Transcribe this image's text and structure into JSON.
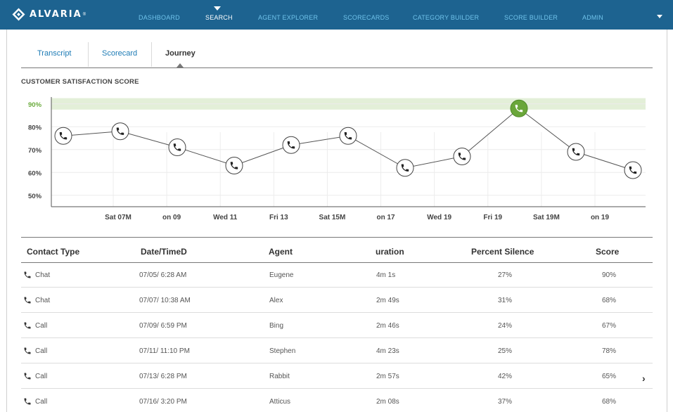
{
  "brand": {
    "name": "ALVARIA",
    "mark": "®"
  },
  "nav": {
    "items": [
      {
        "id": "dashboard",
        "label": "DASHBOARD"
      },
      {
        "id": "search",
        "label": "SEARCH",
        "active": true
      },
      {
        "id": "agent-explorer",
        "label": "AGENT EXPLORER"
      },
      {
        "id": "scorecards",
        "label": "SCORECARDS"
      },
      {
        "id": "category-builder",
        "label": "CATEGORY BUILDER"
      },
      {
        "id": "score-builder",
        "label": "SCORE BUILDER"
      },
      {
        "id": "admin",
        "label": "ADMIN"
      }
    ]
  },
  "tabs": [
    {
      "id": "transcript",
      "label": "Transcript"
    },
    {
      "id": "scorecard",
      "label": "Scorecard"
    },
    {
      "id": "journey",
      "label": "Journey",
      "active": true
    }
  ],
  "section_title": "CUSTOMER SATISFACTION SCORE",
  "colors": {
    "nav_bg": "#1d6390",
    "nav_link": "#6fc2ea",
    "highlight_band": "#e3efd8",
    "highlight_point": "#6aa63a",
    "link": "#1d7bb5"
  },
  "chart_data": {
    "type": "line",
    "title": "CUSTOMER SATISFACTION SCORE",
    "y_ticks": [
      "90%",
      "80%",
      "70%",
      "60%",
      "50%"
    ],
    "y_tick_values": [
      90,
      80,
      70,
      60,
      50
    ],
    "ylim": [
      45,
      93
    ],
    "highlight_band": [
      87.5,
      92.5
    ],
    "x_tick_labels": [
      "Sat 07M",
      "on 09",
      "Wed 11",
      "Fri 13",
      "Sat 15M",
      "on 17",
      "Wed 19",
      "Fri 19",
      "Sat 19M",
      "on 19"
    ],
    "values": [
      76,
      78,
      71,
      63,
      72,
      76,
      62,
      67,
      88,
      69,
      61
    ],
    "highlighted_index": 8,
    "marker_icon": "phone-icon",
    "grid": true
  },
  "table": {
    "columns": [
      "Contact Type",
      "Date/TimeD",
      "Agent",
      "uration",
      "Percent Silence",
      "Score"
    ],
    "rows": [
      {
        "type": "Chat",
        "date": "07/05/ 6:28 AM",
        "agent": "Eugene",
        "duration": "4m 1s",
        "silence": "27%",
        "score": "90%"
      },
      {
        "type": "Chat",
        "date": "07/07/ 10:38 AM",
        "agent": "Alex",
        "duration": "2m 49s",
        "silence": "31%",
        "score": "68%"
      },
      {
        "type": "Call",
        "date": "07/09/ 6:59 PM",
        "agent": "Bing",
        "duration": "2m 46s",
        "silence": "24%",
        "score": "67%"
      },
      {
        "type": "Call",
        "date": "07/11/ 11:10 PM",
        "agent": "Stephen",
        "duration": "4m 23s",
        "silence": "25%",
        "score": "78%"
      },
      {
        "type": "Call",
        "date": "07/13/ 6:28 PM",
        "agent": "Rabbit",
        "duration": "2m 57s",
        "silence": "42%",
        "score": "65%",
        "expand": true
      },
      {
        "type": "Call",
        "date": "07/16/ 3:20 PM",
        "agent": "Atticus",
        "duration": "2m 08s",
        "silence": "37%",
        "score": "68%"
      }
    ]
  }
}
